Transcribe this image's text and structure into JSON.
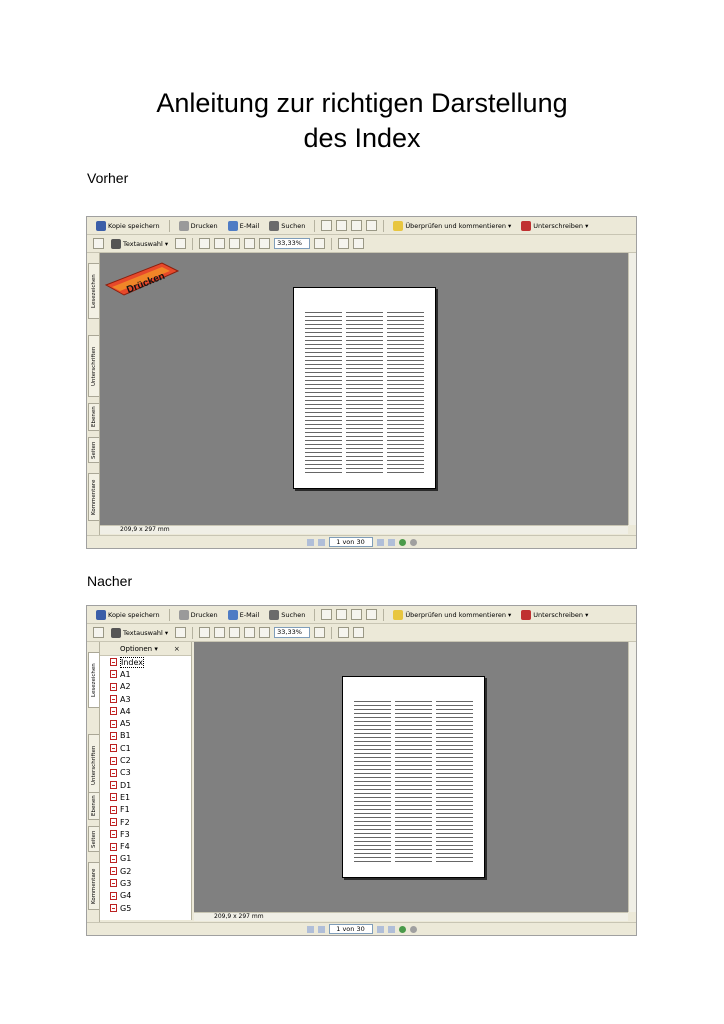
{
  "title_line1": "Anleitung zur richtigen Darstellung",
  "title_line2": "des Index",
  "before_label": "Vorher",
  "after_label": "Nacher",
  "toolbar": {
    "save": "Kopie speichern",
    "print": "Drucken",
    "email": "E-Mail",
    "search": "Suchen",
    "review": "Überprüfen und kommentieren",
    "sign": "Unterschreiben",
    "text_select": "Textauswahl",
    "zoom": "33,33%"
  },
  "sidetabs": [
    "Lesezeichen",
    "Unterschriften",
    "Ebenen",
    "Seiten",
    "Kommentare"
  ],
  "page_size": "209,9 x 297 mm",
  "page_indicator": "1 von 30",
  "print_badge": "Drücken",
  "bookmarks": {
    "options": "Optionen",
    "close": "×",
    "items": [
      "Index",
      "A1",
      "A2",
      "A3",
      "A4",
      "A5",
      "B1",
      "C1",
      "C2",
      "C3",
      "D1",
      "E1",
      "F1",
      "F2",
      "F3",
      "F4",
      "G1",
      "G2",
      "G3",
      "G4",
      "G5"
    ]
  },
  "colors": {
    "workspace": "#808080",
    "chrome": "#ece9d8"
  }
}
